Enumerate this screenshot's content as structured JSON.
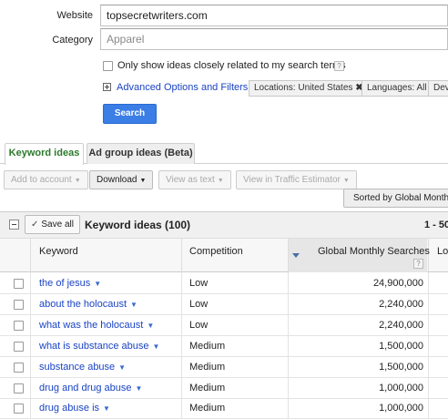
{
  "form": {
    "website_label": "Website",
    "website_value": "topsecretwriters.com",
    "category_label": "Category",
    "category_placeholder": "Apparel",
    "only_show_label": "Only show ideas closely related to my search terms",
    "help_glyph": "?",
    "advanced_label": "Advanced Options and Filters",
    "chips": {
      "locations": "Locations: United States",
      "locations_remove": "✖",
      "languages": "Languages: All",
      "devices": "Devi"
    },
    "search_button": "Search"
  },
  "tabs": [
    {
      "label": "Keyword ideas",
      "active": true
    },
    {
      "label": "Ad group ideas (Beta)",
      "active": false
    }
  ],
  "toolbar": {
    "add_to_account": "Add to account",
    "download": "Download",
    "view_as_text": "View as text",
    "view_in_estimator": "View in Traffic Estimator",
    "caret": "▼",
    "sorted_by": "Sorted by Global Monthly S"
  },
  "grid": {
    "save_all": "Save all",
    "save_check": "✓",
    "title": "Keyword ideas (100)",
    "pager": "1 - 50",
    "columns": {
      "keyword": "Keyword",
      "competition": "Competition",
      "global_monthly": "Global Monthly Searches",
      "local_cut": "Lo",
      "help": "?"
    },
    "rows": [
      {
        "keyword": "the of jesus",
        "competition": "Low",
        "global": "24,900,000"
      },
      {
        "keyword": "about the holocaust",
        "competition": "Low",
        "global": "2,240,000"
      },
      {
        "keyword": "what was the holocaust",
        "competition": "Low",
        "global": "2,240,000"
      },
      {
        "keyword": "what is substance abuse",
        "competition": "Medium",
        "global": "1,500,000"
      },
      {
        "keyword": "substance abuse",
        "competition": "Medium",
        "global": "1,500,000"
      },
      {
        "keyword": "drug and drug abuse",
        "competition": "Medium",
        "global": "1,000,000"
      },
      {
        "keyword": "drug abuse is",
        "competition": "Medium",
        "global": "1,000,000"
      }
    ],
    "row_dropdown_glyph": "▼"
  },
  "colors": {
    "link": "#1a44c4",
    "search_button": "#3a7ee6",
    "active_tab_text": "#2b7a2b"
  }
}
